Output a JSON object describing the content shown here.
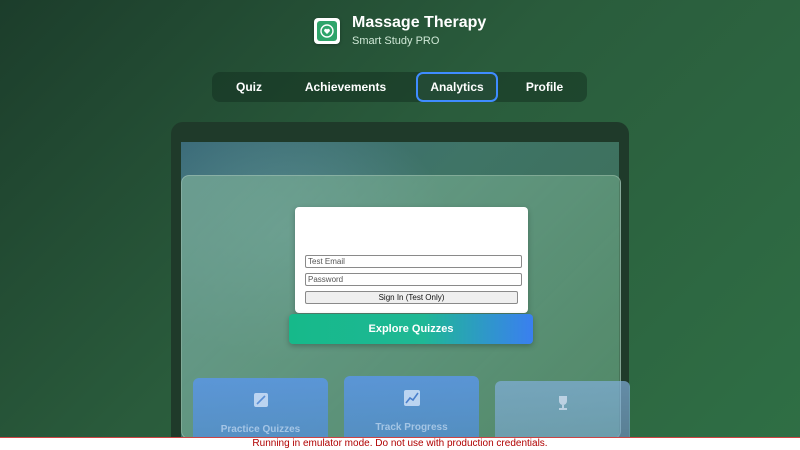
{
  "app": {
    "title": "Massage Therapy",
    "subtitle": "Smart Study PRO",
    "logo_icon": "heart-hands-icon",
    "brand_color": "#2fa46a"
  },
  "nav": {
    "active": "Analytics",
    "tabs": [
      {
        "label": "Quiz"
      },
      {
        "label": "Achievements"
      },
      {
        "label": "Analytics"
      },
      {
        "label": "Profile"
      }
    ],
    "active_border_color": "#3f8cff"
  },
  "login": {
    "heading": "",
    "email_placeholder": "Test Email",
    "password_placeholder": "Password",
    "sign_in_label": "Sign In (Test Only)"
  },
  "hero": {
    "explore_label": "Explore Quizzes"
  },
  "features": [
    {
      "label": "Practice Quizzes",
      "icon": "notepad-icon"
    },
    {
      "label": "Track Progress",
      "icon": "chart-line-icon"
    },
    {
      "label": "",
      "icon": "trophy-icon"
    }
  ],
  "banner": {
    "text": "Running in emulator mode. Do not use with production credentials.",
    "color": "#b00000"
  }
}
